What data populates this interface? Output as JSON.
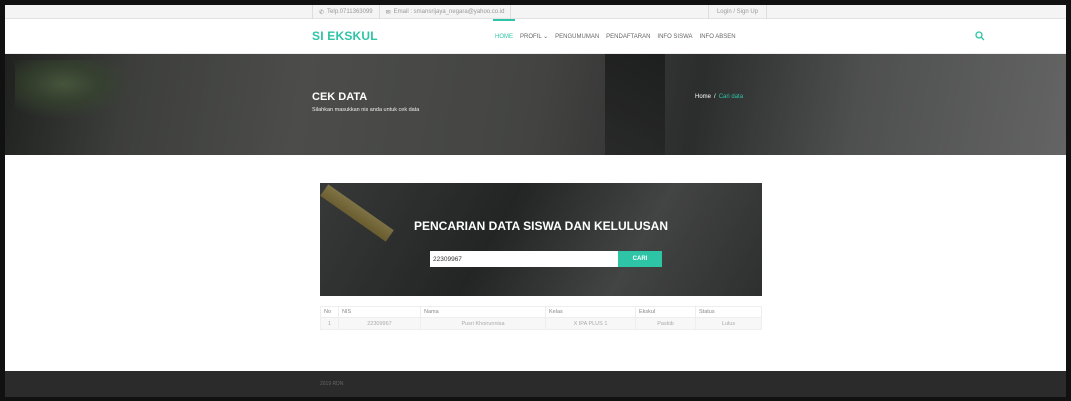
{
  "topbar": {
    "phone": "Telp.0711363099",
    "email": "Email : smansrijaya_negara@yahoo.co.id",
    "login": "Login / Sign Up"
  },
  "navbar": {
    "brand": "SI EKSKUL",
    "menu": [
      {
        "label": "HOME",
        "active": true
      },
      {
        "label": "PROFIL ⌄",
        "active": false
      },
      {
        "label": "PENGUMUMAN",
        "active": false
      },
      {
        "label": "PENDAFTARAN",
        "active": false
      },
      {
        "label": "INFO SISWA",
        "active": false
      },
      {
        "label": "INFO ABSEN",
        "active": false
      }
    ],
    "search_icon": "search-icon"
  },
  "hero": {
    "title": "CEK DATA",
    "subtitle": "Silahkan masukkan nis anda untuk cek data",
    "breadcrumb": {
      "home": "Home",
      "sep": "/",
      "current": "Cari data"
    }
  },
  "search": {
    "title": "PENCARIAN DATA SISWA DAN KELULUSAN",
    "value": "22309967",
    "button": "CARI"
  },
  "results": {
    "headers": [
      "No",
      "NIS",
      "Nama",
      "Kelas",
      "Ekskul",
      "Status"
    ],
    "rows": [
      [
        "1",
        "22309967",
        "Pusri Khoirunnisa",
        "X IPA PLUS 1",
        "Paskib",
        "Lulus"
      ]
    ]
  },
  "footer": {
    "text": "2019 RDN"
  },
  "colors": {
    "accent": "#2ec4a6",
    "footer": "#2b2b2b"
  }
}
